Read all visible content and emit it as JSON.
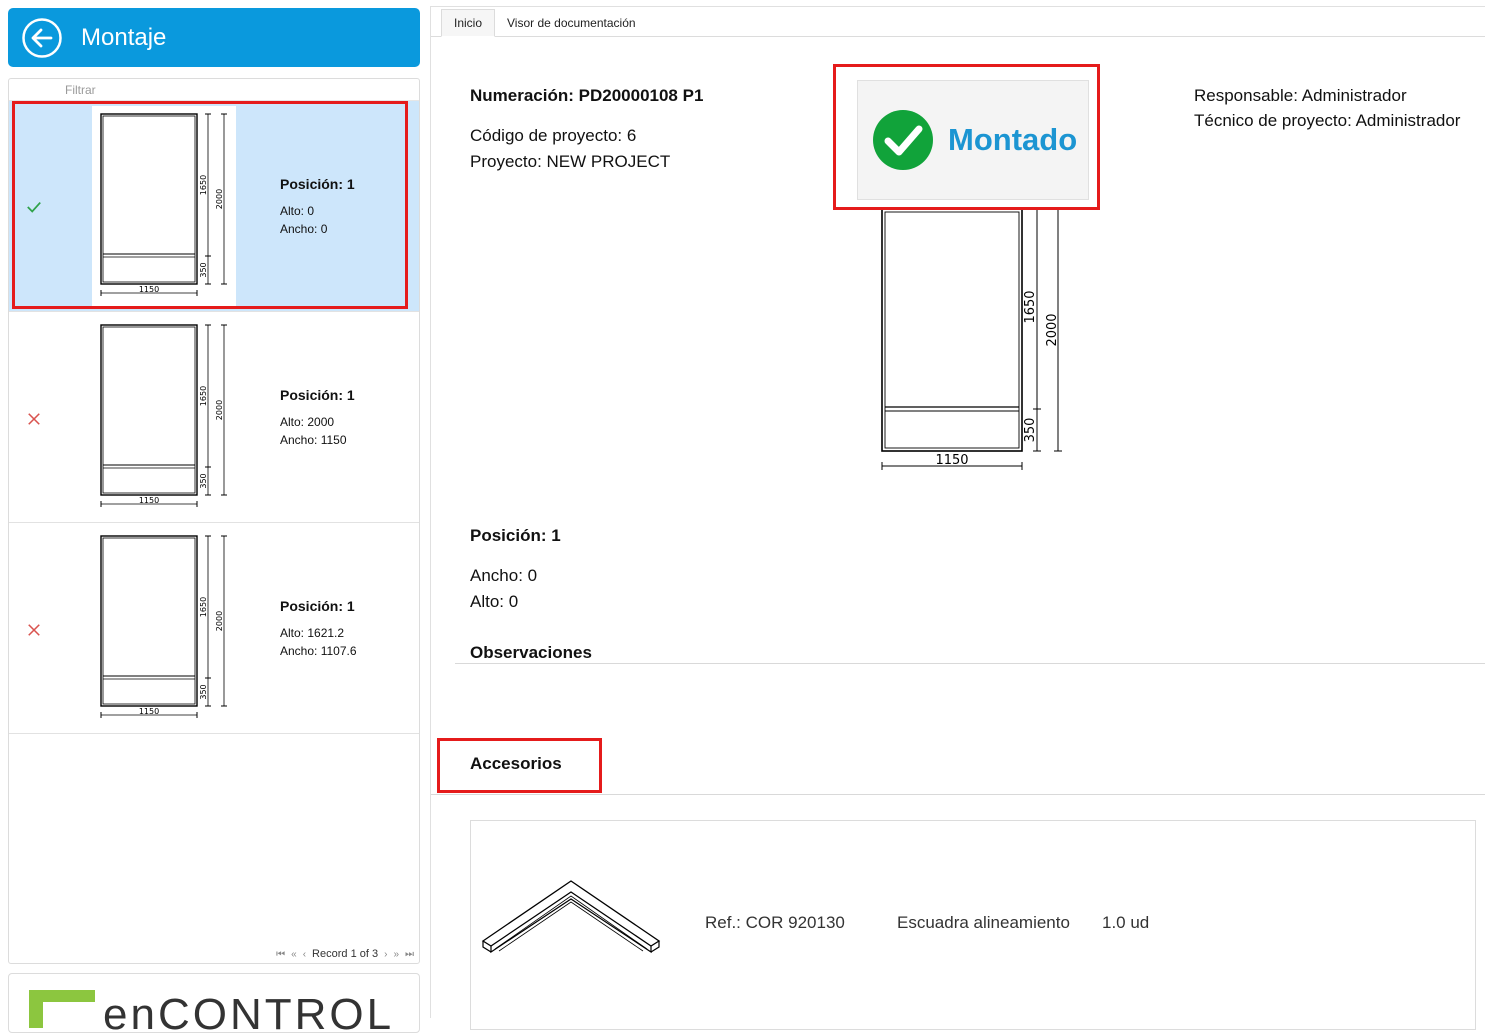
{
  "header": {
    "title": "Montaje",
    "back_icon": "arrow-left-circle-icon",
    "color": "#0a99dd"
  },
  "filter": {
    "placeholder": "Filtrar"
  },
  "positions": [
    {
      "status": "ok",
      "status_icon": "check-icon",
      "position_label": "Posición: 1",
      "alto_label": "Alto: 0",
      "ancho_label": "Ancho: 0",
      "selected": true,
      "dims": {
        "width": "1150",
        "height": "2000",
        "upper": "1650",
        "lower": "350"
      }
    },
    {
      "status": "ko",
      "status_icon": "cross-icon",
      "position_label": "Posición: 1",
      "alto_label": "Alto: 2000",
      "ancho_label": "Ancho: 1150",
      "selected": false,
      "dims": {
        "width": "1150",
        "height": "2000",
        "upper": "1650",
        "lower": "350"
      }
    },
    {
      "status": "ko",
      "status_icon": "cross-icon",
      "position_label": "Posición: 1",
      "alto_label": "Alto: 1621.2",
      "ancho_label": "Ancho: 1107.6",
      "selected": false,
      "dims": {
        "width": "1150",
        "height": "2000",
        "upper": "1650",
        "lower": "350"
      }
    }
  ],
  "pager": {
    "text": "Record 1 of 3"
  },
  "logo": {
    "text": "enCONTROL"
  },
  "tabs": [
    {
      "label": "Inicio",
      "active": true
    },
    {
      "label": "Visor de documentación",
      "active": false
    }
  ],
  "detail": {
    "numeracion": "Numeración: PD20000108 P1",
    "codigo": "Código de proyecto: 6",
    "proyecto": "Proyecto: NEW PROJECT",
    "responsable": "Responsable: Administrador",
    "tecnico": "Técnico de proyecto: Administrador",
    "montado_label": "Montado",
    "montado_color": "#1c95d2",
    "check_color": "#11a33a",
    "drawing": {
      "width": "1150",
      "height": "2000",
      "upper": "1650",
      "lower": "350"
    },
    "position_title": "Posición: 1",
    "ancho": "Ancho: 0",
    "alto": "Alto: 0",
    "observaciones_title": "Observaciones",
    "accesorios_title": "Accesorios"
  },
  "accessories": [
    {
      "ref": "Ref.: COR 920130",
      "description": "Escuadra alineamiento",
      "quantity": "1.0 ud"
    }
  ],
  "highlight_color": "#e51b1b"
}
